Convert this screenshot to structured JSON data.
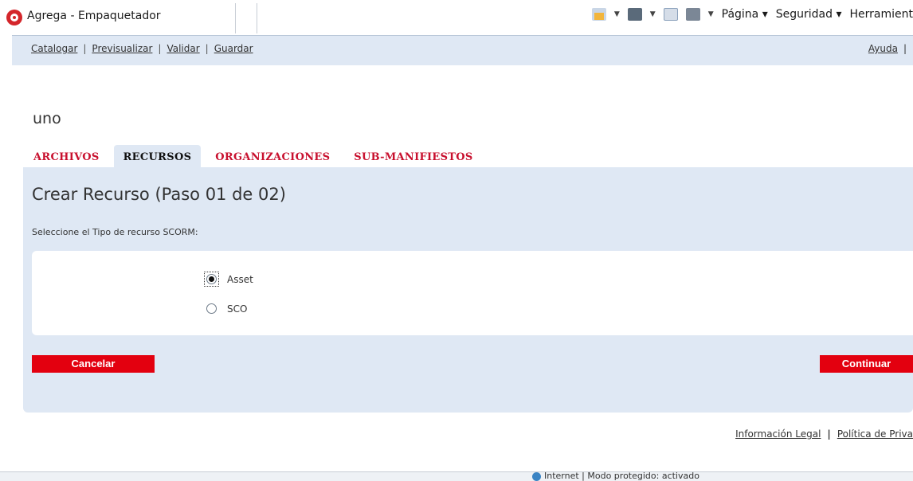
{
  "browser": {
    "tab_title": "Agrega - Empaquetador",
    "menu_pagina": "Página ▾",
    "menu_seguridad": "Seguridad ▾",
    "menu_herramientas": "Herramient",
    "status_text": "Internet | Modo protegido: activado"
  },
  "top_nav": {
    "links": [
      "Catalogar",
      "Previsualizar",
      "Validar",
      "Guardar"
    ],
    "help": "Ayuda"
  },
  "page": {
    "title": "uno"
  },
  "tabs": [
    {
      "label": "ARCHIVOS",
      "active": false
    },
    {
      "label": "RECURSOS",
      "active": true
    },
    {
      "label": "ORGANIZACIONES",
      "active": false
    },
    {
      "label": "SUB-MANIFIESTOS",
      "active": false
    }
  ],
  "panel": {
    "heading": "Crear Recurso (Paso 01 de 02)",
    "instruction": "Seleccione el Tipo de recurso SCORM:",
    "options": [
      {
        "label": "Asset",
        "checked": true
      },
      {
        "label": "SCO",
        "checked": false
      }
    ],
    "cancel_label": "Cancelar",
    "continue_label": "Continuar"
  },
  "footer": {
    "legal": "Información Legal",
    "privacy": "Política de Priva"
  },
  "colors": {
    "accent_red": "#e3000f",
    "tab_red": "#c8102e",
    "panel_bg": "#dfe8f4"
  }
}
